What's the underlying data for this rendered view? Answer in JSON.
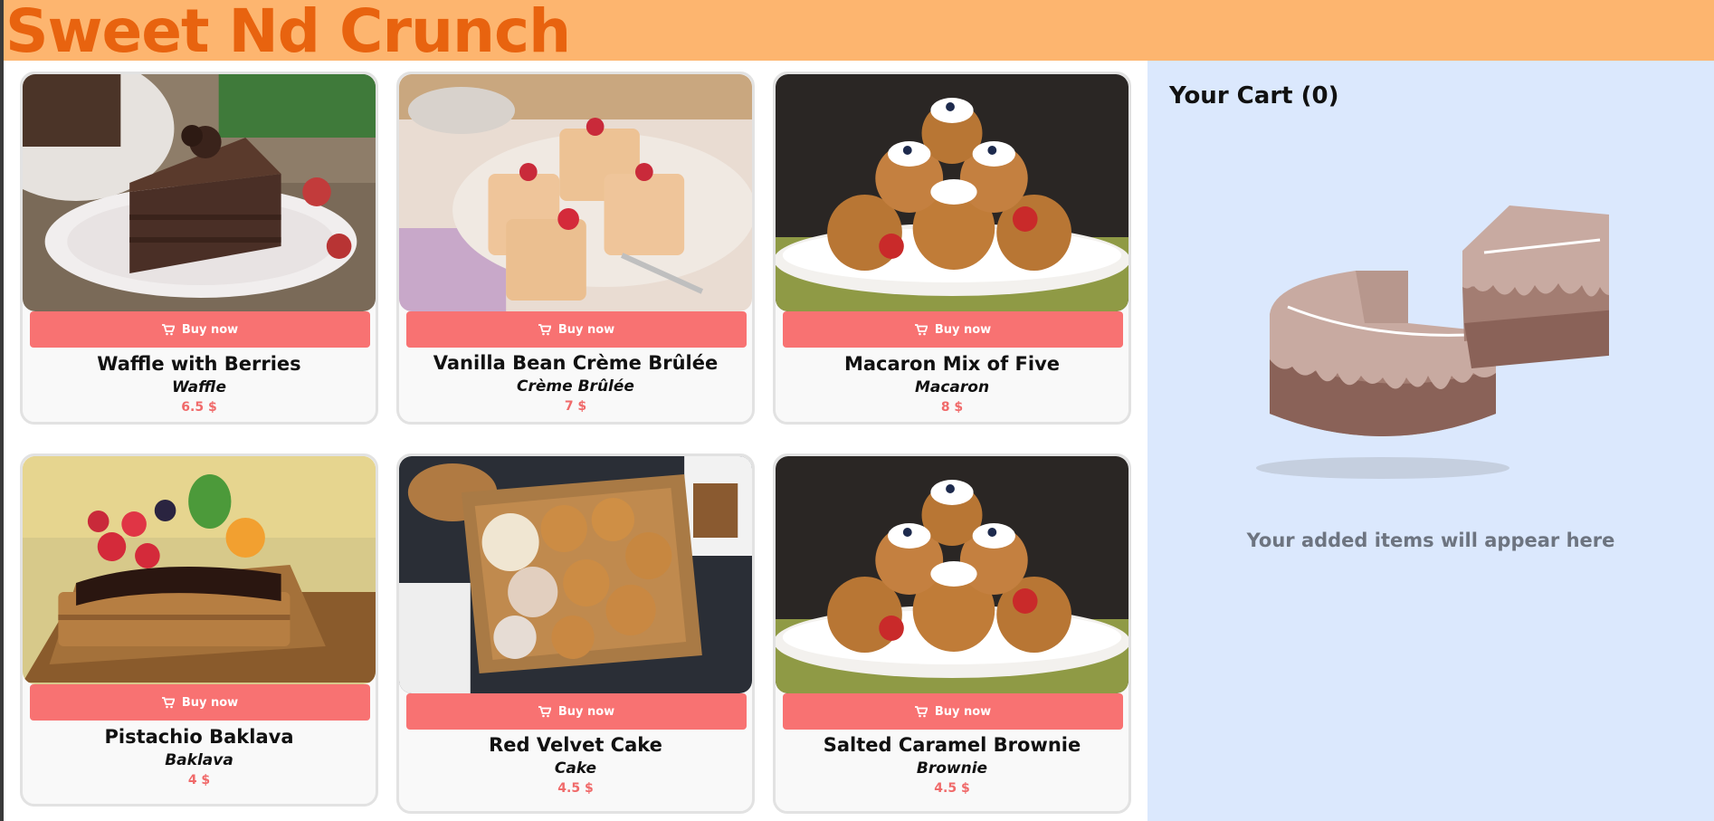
{
  "header": {
    "title": "Sweet Nd Crunch"
  },
  "products": [
    {
      "name": "Waffle with Berries",
      "category": "Waffle",
      "price": "6.5 $",
      "buy_label": "Buy now",
      "image": "chocolate-cake-slice"
    },
    {
      "name": "Vanilla Bean Crème Brûlée",
      "category": "Crème Brûlée",
      "price": "7 $",
      "buy_label": "Buy now",
      "image": "berry-puff-pastries"
    },
    {
      "name": "Macaron Mix of Five",
      "category": "Macaron",
      "price": "8 $",
      "buy_label": "Buy now",
      "image": "cream-topped-cakes"
    },
    {
      "name": "Pistachio Baklava",
      "category": "Baklava",
      "price": "4 $",
      "buy_label": "Buy now",
      "image": "fruit-topped-cake"
    },
    {
      "name": "Red Velvet Cake",
      "category": "Cake",
      "price": "4.5 $",
      "buy_label": "Buy now",
      "image": "pastry-basket"
    },
    {
      "name": "Salted Caramel Brownie",
      "category": "Brownie",
      "price": "4.5 $",
      "buy_label": "Buy now",
      "image": "cream-topped-cakes"
    }
  ],
  "cart": {
    "title": "Your Cart (0)",
    "empty_message": "Your added items will appear here"
  },
  "colors": {
    "header_bg": "#fdb56f",
    "brand": "#e8630f",
    "button": "#f87272",
    "price": "#f06a6a",
    "cart_bg": "#dbe8fd"
  },
  "icons": {
    "buy": "cart-icon",
    "empty_cart": "cake-illustration"
  }
}
